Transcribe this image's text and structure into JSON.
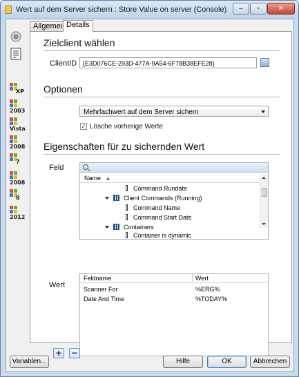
{
  "window": {
    "title": "Wert auf dem Server sichern : Store Value on server (Console)",
    "controls": [
      "–",
      "▫",
      "✕"
    ]
  },
  "sidebar": {
    "os_items": [
      "XP",
      "2003",
      "Vista",
      "2008",
      "7",
      "2008",
      "8",
      "2012"
    ]
  },
  "tabs": [
    {
      "label": "Allgemein",
      "active": false
    },
    {
      "label": "Details",
      "active": true
    }
  ],
  "section_client": {
    "title": "Zielclient wählen",
    "client_label": "ClientID",
    "client_value": "{E3D076CE-293D-477A-9A54-6F78B38EFE28}"
  },
  "section_options": {
    "title": "Optionen",
    "dropdown_value": "Mehrfachwert auf dem Server sichern",
    "checkbox_label": "Lösche vorherige Werte",
    "checkbox_checked": true
  },
  "section_props": {
    "title": "Eigenschaften für zu sichernden Wert",
    "feld_label": "Feld",
    "tree_header": "Name",
    "tree_rows": [
      {
        "label": "Command Rundate",
        "type": "field"
      },
      {
        "label": "Client Commands (Running)",
        "type": "table"
      },
      {
        "label": "Command Name",
        "type": "field"
      },
      {
        "label": "Command Start Date",
        "type": "field"
      },
      {
        "label": "Containers",
        "type": "table"
      },
      {
        "label": "Container is dynamic",
        "type": "field"
      }
    ],
    "wert_label": "Wert",
    "grid_headers": [
      "Feldname",
      "Wert"
    ],
    "grid_rows": [
      {
        "feldname": "Scanner For",
        "wert": "%ERG%"
      },
      {
        "feldname": "Date And Time",
        "wert": "%TODAY%"
      }
    ],
    "add_label": "+",
    "remove_label": "−"
  },
  "footer": {
    "variables_label": "Variablen...",
    "help_label": "Hilfe",
    "ok_label": "OK",
    "cancel_label": "Abbrechen"
  }
}
